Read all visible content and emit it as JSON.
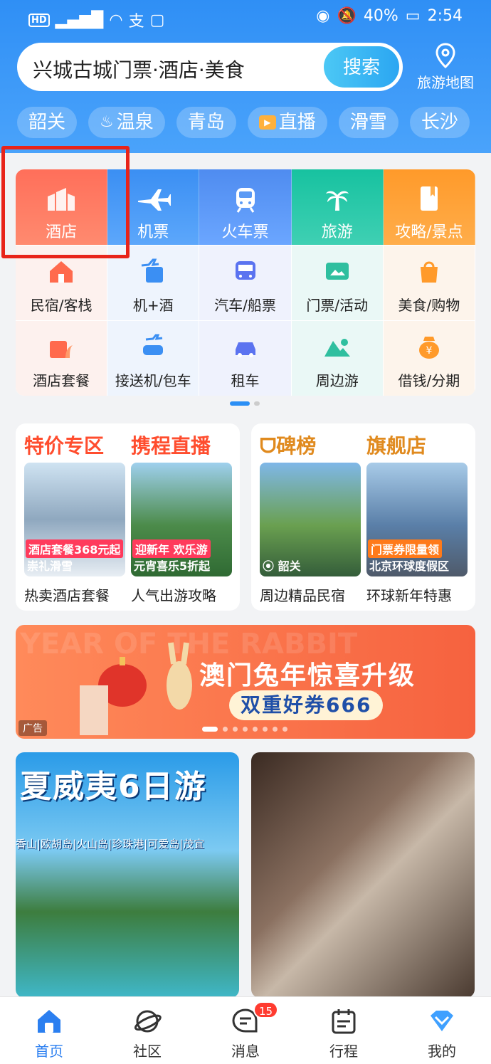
{
  "status": {
    "left_icons": "HD 46 signal wifi alipay wechat",
    "battery": "40%",
    "time": "2:54",
    "hd": "HD"
  },
  "search": {
    "placeholder": "兴城古城门票·酒店·美食",
    "button": "搜索",
    "map_label": "旅游地图"
  },
  "chips": [
    "韶关",
    "温泉",
    "青岛",
    "直播",
    "滑雪",
    "长沙"
  ],
  "main_tiles": [
    "酒店",
    "机票",
    "火车票",
    "旅游",
    "攻略/景点"
  ],
  "sub_row1": [
    "民宿/客栈",
    "机+酒",
    "汽车/船票",
    "门票/活动",
    "美食/购物"
  ],
  "sub_row2": [
    "酒店套餐",
    "接送机/包车",
    "租车",
    "周边游",
    "借钱/分期"
  ],
  "promo_left": {
    "h1": "特价专区",
    "h2": "携程直播",
    "tag1": "酒店套餐368元起",
    "tag1b": "崇礼滑雪",
    "tag2": "迎新年 欢乐游",
    "tag2b": "元宵喜乐5折起",
    "cap1": "热卖酒店套餐",
    "cap2": "人气出游攻略"
  },
  "promo_right": {
    "h1": "碑榜",
    "h2": "旗舰店",
    "tag1": "韶关",
    "tag2": "门票券限量领",
    "tag2b": "北京环球度假区",
    "cap1": "周边精品民宿",
    "cap2": "环球新年特惠"
  },
  "banner": {
    "title": "澳门兔年惊喜升级",
    "sub": "双重好券666",
    "ad": "广告",
    "bg_text": "YEAR OF THE RABBIT"
  },
  "feed": {
    "title": "夏威夷6日游",
    "subtitle": "香山|欧胡岛|火山岛|珍珠港|可爱岛|茂宜"
  },
  "tabs": [
    "首页",
    "社区",
    "消息",
    "行程",
    "我的"
  ],
  "msg_badge": "15",
  "colors": {
    "accent": "#2b8ff5",
    "hotel": "#ff6f5a",
    "highlight": "#e8241a"
  }
}
